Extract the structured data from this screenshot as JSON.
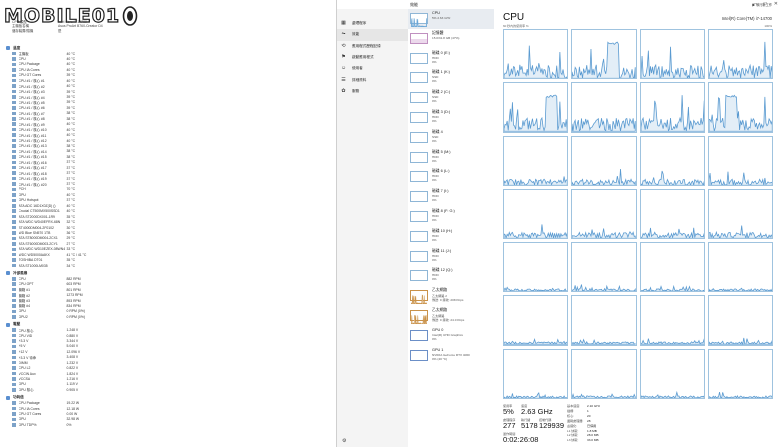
{
  "watermark": {
    "text": "MOBILE01"
  },
  "aida": {
    "header": [
      {
        "k": "CPU 類型",
        "v": "Intel Core i7-14700"
      },
      {
        "k": "主機板名稱",
        "v": "Asus ProArt B760-Creator D4"
      },
      {
        "k": "儲存裝置/隨機",
        "v": "是"
      }
    ],
    "sections": [
      {
        "title": "溫度",
        "rows": [
          {
            "l": "主機板",
            "v": "40 °C"
          },
          {
            "l": "CPU",
            "v": "40 °C"
          },
          {
            "l": "CPU Package",
            "v": "40 °C"
          },
          {
            "l": "CPU IA Cores",
            "v": "40 °C"
          },
          {
            "l": "CPU GT Cores",
            "v": "39 °C"
          },
          {
            "l": "CPU #1 / 核心 #1",
            "v": "40 °C"
          },
          {
            "l": "CPU #1 / 核心 #2",
            "v": "40 °C"
          },
          {
            "l": "CPU #1 / 核心 #3",
            "v": "39 °C"
          },
          {
            "l": "CPU #1 / 核心 #4",
            "v": "39 °C"
          },
          {
            "l": "CPU #1 / 核心 #5",
            "v": "39 °C"
          },
          {
            "l": "CPU #1 / 核心 #6",
            "v": "39 °C"
          },
          {
            "l": "CPU #1 / 核心 #7",
            "v": "38 °C"
          },
          {
            "l": "CPU #1 / 核心 #8",
            "v": "38 °C"
          },
          {
            "l": "CPU #1 / 核心 #9",
            "v": "40 °C"
          },
          {
            "l": "CPU #1 / 核心 #10",
            "v": "40 °C"
          },
          {
            "l": "CPU #1 / 核心 #11",
            "v": "40 °C"
          },
          {
            "l": "CPU #1 / 核心 #12",
            "v": "40 °C"
          },
          {
            "l": "CPU #1 / 核心 #13",
            "v": "38 °C"
          },
          {
            "l": "CPU #1 / 核心 #14",
            "v": "38 °C"
          },
          {
            "l": "CPU #1 / 核心 #15",
            "v": "38 °C"
          },
          {
            "l": "CPU #1 / 核心 #16",
            "v": "37 °C"
          },
          {
            "l": "CPU #1 / 核心 #17",
            "v": "37 °C"
          },
          {
            "l": "CPU #1 / 核心 #18",
            "v": "37 °C"
          },
          {
            "l": "CPU #1 / 核心 #19",
            "v": "37 °C"
          },
          {
            "l": "CPU #1 / 核心 #20",
            "v": "37 °C"
          },
          {
            "l": "PCH",
            "v": "70 °C"
          },
          {
            "l": "GPU",
            "v": "40 °C"
          },
          {
            "l": "GPU Hotspot",
            "v": "37 °C"
          },
          {
            "l": "ATA ADC 16D1X0Z(D) ()",
            "v": "40 °C"
          },
          {
            "l": "Crucial CT500MX500SSD1",
            "v": "40 °C"
          },
          {
            "l": "ATA ST2000DX001-1R9",
            "v": "35 °C"
          },
          {
            "l": "ATA WDC WD40EFRX-68N",
            "v": "32 °C"
          },
          {
            "l": "ST4000DM004-2F0102",
            "v": "30 °C"
          },
          {
            "l": "WD Blue SN570 1TB",
            "v": "36 °C"
          },
          {
            "l": "ATA ST8000DM004-2CX1",
            "v": "29 °C"
          },
          {
            "l": "ATA ST6000DM003-2CY1",
            "v": "27 °C"
          },
          {
            "l": "ATA WDC WD10EZEX-08WN4",
            "v": "33 °C"
          },
          {
            "l": "WDC WD5000AAKX",
            "v": "41 °C / 41 °C"
          },
          {
            "l": "TOSHIBA DT01",
            "v": "35 °C"
          },
          {
            "l": "ATA ST1000LM035",
            "v": "34 °C"
          }
        ]
      },
      {
        "title": "冷卻風扇",
        "rows": [
          {
            "l": "CPU",
            "v": "882 RPM"
          },
          {
            "l": "CPU OPT",
            "v": "603 RPM"
          },
          {
            "l": "機箱 #1",
            "v": "801 RPM"
          },
          {
            "l": "機箱 #2",
            "v": "1273 RPM"
          },
          {
            "l": "機箱 #3",
            "v": "893 RPM"
          },
          {
            "l": "機箱 #4",
            "v": "834 RPM"
          },
          {
            "l": "GPU",
            "v": "0 RPM (0%)"
          },
          {
            "l": "GPU2",
            "v": "0 RPM (0%)"
          }
        ]
      },
      {
        "title": "電壓",
        "rows": [
          {
            "l": "CPU 核心",
            "v": "1.248 V"
          },
          {
            "l": "CPU VID",
            "v": "0.880 V"
          },
          {
            "l": "+3.3 V",
            "v": "3.344 V"
          },
          {
            "l": "+5 V",
            "v": "5.040 V"
          },
          {
            "l": "+12 V",
            "v": "12.096 V"
          },
          {
            "l": "+3.3 V 待命",
            "v": "3.408 V"
          },
          {
            "l": "DIMM",
            "v": "1.232 V"
          },
          {
            "l": "CPU L2",
            "v": "0.822 V"
          },
          {
            "l": "VCCIN Aux",
            "v": "1.824 V"
          },
          {
            "l": "VCCSA",
            "v": "1.216 V"
          },
          {
            "l": "GPU",
            "v": "1.119 V"
          },
          {
            "l": "GPU 核心",
            "v": "0.905 V"
          }
        ]
      },
      {
        "title": "功耗值",
        "rows": [
          {
            "l": "CPU Package",
            "v": "19.22 W"
          },
          {
            "l": "CPU IA Cores",
            "v": "12.18 W"
          },
          {
            "l": "CPU GT Cores",
            "v": "0.00 W"
          },
          {
            "l": "GPU",
            "v": "32.98 W"
          },
          {
            "l": "GPU TDP%",
            "v": "0%"
          }
        ]
      }
    ]
  },
  "tm": {
    "window_title": "效能",
    "controls": {
      "minimize": "─",
      "maximize": "□",
      "close": "✕"
    },
    "nav": [
      {
        "label": "處理程序",
        "icon": "▦"
      },
      {
        "label": "效能",
        "icon": "⏦"
      },
      {
        "label": "應用程式歷程記錄",
        "icon": "⟲"
      },
      {
        "label": "啟動應用程式",
        "icon": "⚑"
      },
      {
        "label": "使用者",
        "icon": "☺"
      },
      {
        "label": "詳細資料",
        "icon": "☰"
      },
      {
        "label": "服務",
        "icon": "✿"
      }
    ],
    "perf_items": [
      {
        "name": "CPU",
        "sub": "5% 2.63 GHz",
        "sub2": "",
        "kind": "cpu"
      },
      {
        "name": "記憶體",
        "sub": "15.0/31.8 GB (47%)",
        "sub2": "",
        "kind": "mem"
      },
      {
        "name": "磁碟 0 (E:)",
        "sub": "HDD",
        "sub2": "0%",
        "kind": "disk"
      },
      {
        "name": "磁碟 1 (K:)",
        "sub": "SSD",
        "sub2": "0%",
        "kind": "disk"
      },
      {
        "name": "磁碟 2 (C:)",
        "sub": "SSD",
        "sub2": "0%",
        "kind": "disk"
      },
      {
        "name": "磁碟 3 (D:)",
        "sub": "HDD",
        "sub2": "0%",
        "kind": "disk"
      },
      {
        "name": "磁碟 4",
        "sub": "SSD",
        "sub2": "0%",
        "kind": "disk"
      },
      {
        "name": "磁碟 5 (M:)",
        "sub": "HDD",
        "sub2": "0%",
        "kind": "disk"
      },
      {
        "name": "磁碟 6 (L:)",
        "sub": "HDD",
        "sub2": "0%",
        "kind": "disk"
      },
      {
        "name": "磁碟 7 (I:)",
        "sub": "HDD",
        "sub2": "0%",
        "kind": "disk"
      },
      {
        "name": "磁碟 8 (F: G:)",
        "sub": "HDD",
        "sub2": "0%",
        "kind": "disk"
      },
      {
        "name": "磁碟 10 (H:)",
        "sub": "HDD",
        "sub2": "0%",
        "kind": "disk"
      },
      {
        "name": "磁碟 11 (J:)",
        "sub": "HDD",
        "sub2": "0%",
        "kind": "disk"
      },
      {
        "name": "磁碟 12 (Q:)",
        "sub": "HDD",
        "sub2": "0%",
        "kind": "disk"
      },
      {
        "name": "乙太網路",
        "sub": "乙太網路 2",
        "sub2": "傳送: 0 接收: 208 Kbps",
        "kind": "net"
      },
      {
        "name": "乙太網路",
        "sub": "乙太網路",
        "sub2": "傳送: 0 接收: 24.0 Kbps",
        "kind": "net"
      },
      {
        "name": "GPU 0",
        "sub": "Intel(R) UHD Graphics",
        "sub2": "0%",
        "kind": "gpu"
      },
      {
        "name": "GPU 1",
        "sub": "NVIDIA GeForce RTX 4060",
        "sub2": "0% (40 °C)",
        "kind": "gpu"
      }
    ],
    "detail": {
      "title": "CPU",
      "model": "Intel(R) Core(TM) i7-14700",
      "graph_label": "60 秒內的使用率 %",
      "graph_max": "100%",
      "action": "執行新工作",
      "stats": [
        {
          "label": "使用率",
          "value": "5%"
        },
        {
          "label": "速度",
          "value": "2.63 GHz"
        },
        {
          "label": "處理程序",
          "value": "277"
        },
        {
          "label": "執行緒",
          "value": "5178"
        },
        {
          "label": "控制代碼",
          "value": "129939"
        },
        {
          "label": "運作時間",
          "value": "0:02:26:08"
        }
      ],
      "specs": [
        {
          "k": "基本速度:",
          "v": "2.10 GHz"
        },
        {
          "k": "插槽:",
          "v": "1"
        },
        {
          "k": "核心:",
          "v": "20"
        },
        {
          "k": "邏輯處理器:",
          "v": "28"
        },
        {
          "k": "虛擬化:",
          "v": "已停用"
        },
        {
          "k": "L1 快取:",
          "v": "1.8 MB"
        },
        {
          "k": "L2 快取:",
          "v": "28.0 MB"
        },
        {
          "k": "L3 快取:",
          "v": "33.0 MB"
        }
      ]
    }
  }
}
